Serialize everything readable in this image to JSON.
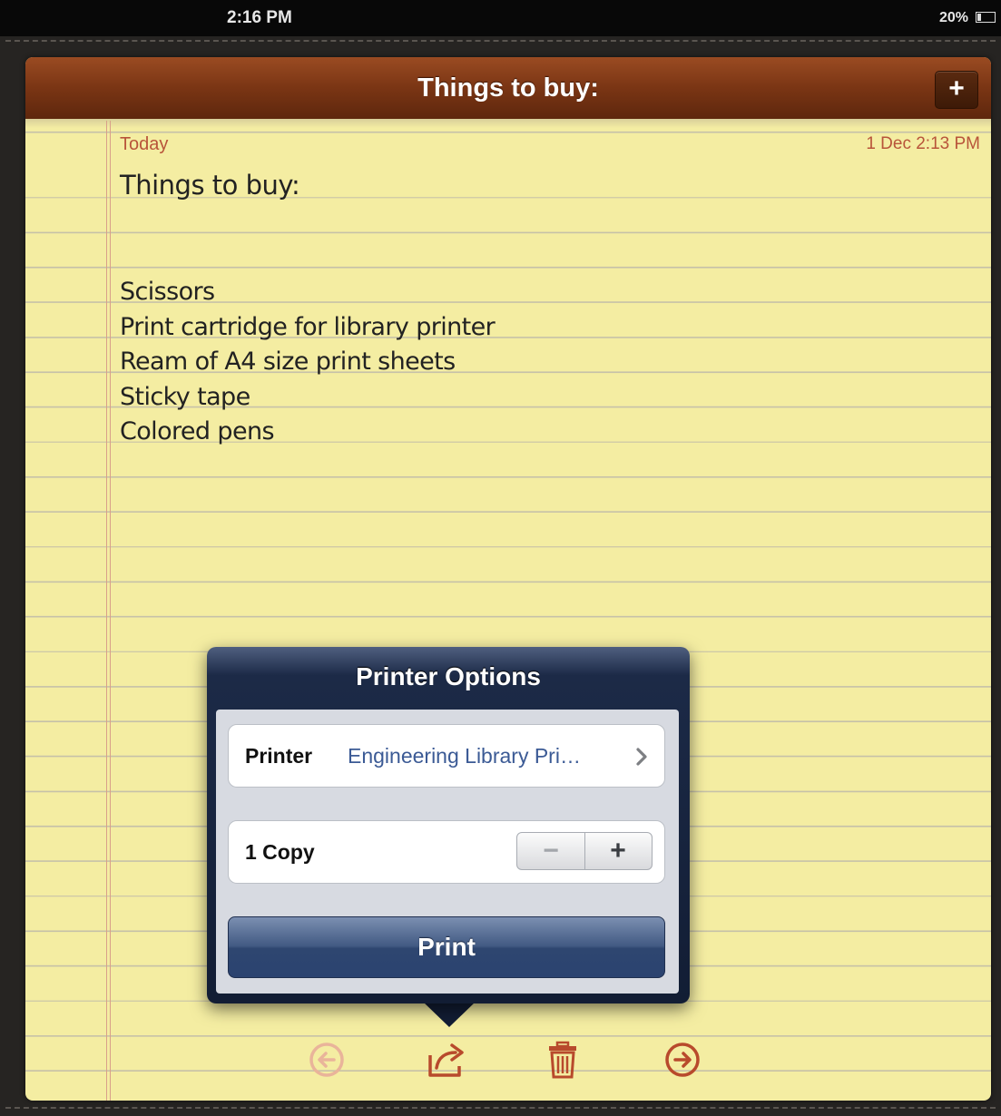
{
  "status_bar": {
    "time": "2:16 PM",
    "battery": "20%"
  },
  "header": {
    "title": "Things to buy:",
    "add_label": "+"
  },
  "note": {
    "date_label": "Today",
    "date": "1 Dec   2:13 PM",
    "title": "Things to buy:",
    "items": [
      "Scissors",
      "Print cartridge for library printer",
      "Ream of A4 size print sheets",
      "Sticky tape",
      "Colored pens"
    ]
  },
  "popover": {
    "title": "Printer Options",
    "printer_label": "Printer",
    "printer_value": "Engineering Library Pri…",
    "copies_label": "1 Copy",
    "stepper_minus": "−",
    "stepper_plus": "+",
    "print_label": "Print"
  },
  "toolbar": {
    "icons": [
      "previous-note-icon",
      "share-icon",
      "trash-icon",
      "next-note-icon"
    ]
  },
  "colors": {
    "paper": "#f4eda2",
    "header_leather": "#7a3514",
    "accent_red": "#b8543a",
    "popover_navy": "#1c2a47",
    "link_blue": "#3b5a95"
  }
}
